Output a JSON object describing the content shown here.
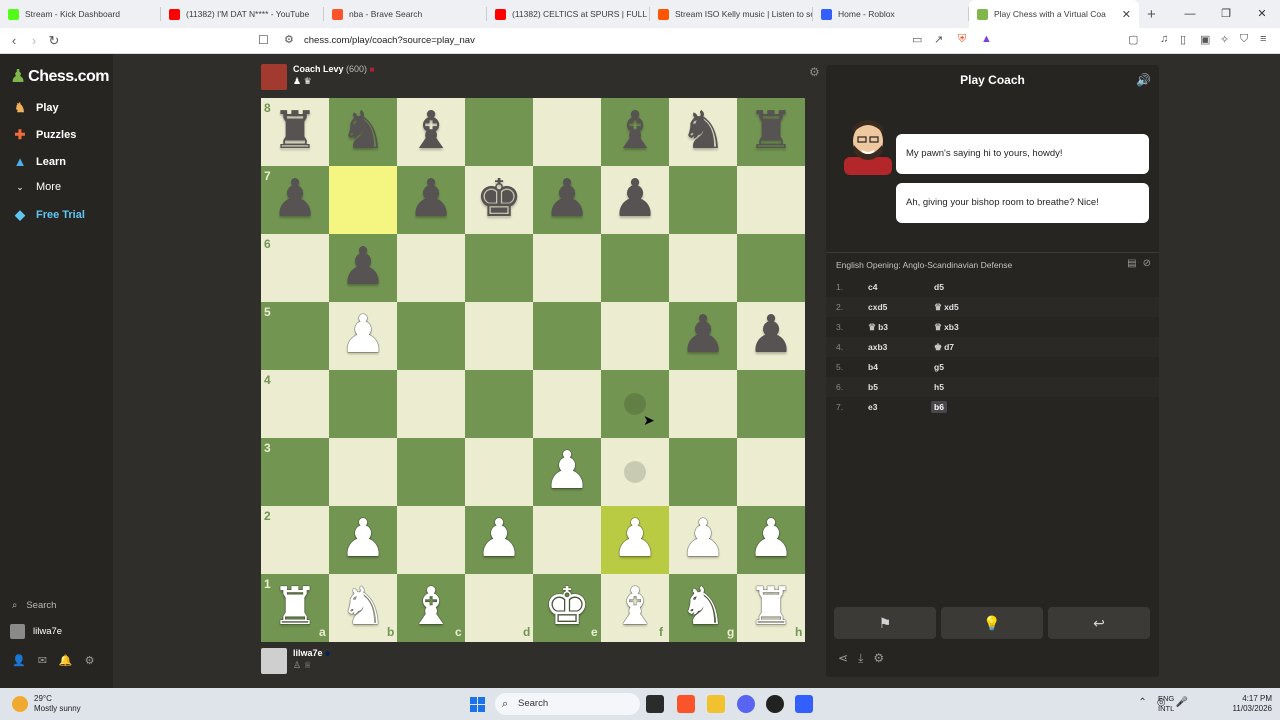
{
  "browser": {
    "tabs": [
      {
        "title": "Stream - Kick Dashboard",
        "color": "#53fc18"
      },
      {
        "title": "(11382) I'M DAT N**** - YouTube",
        "color": "#ff0000"
      },
      {
        "title": "nba - Brave Search",
        "color": "#fb542b"
      },
      {
        "title": "(11382) CELTICS at SPURS | FULL GA",
        "color": "#ff0000"
      },
      {
        "title": "Stream ISO Kelly music | Listen to so",
        "color": "#ff5500"
      },
      {
        "title": "Home - Roblox",
        "color": "#335fff"
      },
      {
        "title": "Play Chess with a Virtual Coa",
        "color": "#81b64c"
      }
    ],
    "url": "chess.com/play/coach?source=play_nav"
  },
  "sidebar": {
    "logo_text": "Chess.com",
    "items": [
      {
        "label": "Play",
        "icon": "play-hand-icon"
      },
      {
        "label": "Puzzles",
        "icon": "puzzle-icon"
      },
      {
        "label": "Learn",
        "icon": "graduation-cap-icon"
      },
      {
        "label": "More",
        "icon": "chevron-down-icon"
      },
      {
        "label": "Free Trial",
        "icon": "diamond-icon"
      }
    ],
    "search_label": "Search",
    "username": "lilwa7e"
  },
  "top_player": {
    "name": "Coach Levy",
    "rating": "(600)"
  },
  "bottom_player": {
    "name": "lilwa7e"
  },
  "board": {
    "light_color": "#ebecd0",
    "dark_color": "#739552",
    "ranks": [
      "8",
      "7",
      "6",
      "5",
      "4",
      "3",
      "2",
      "1"
    ],
    "files": [
      "a",
      "b",
      "c",
      "d",
      "e",
      "f",
      "g",
      "h"
    ],
    "rows": [
      "rnb..bnr",
      "p.pkpp..",
      ".p......",
      ".P....pp",
      "........",
      "....P...",
      ".P.P.PPP",
      "RNB.KBNR"
    ],
    "highlights": [
      [
        1,
        1
      ],
      [
        6,
        5
      ]
    ],
    "hints": [
      [
        4,
        5
      ],
      [
        5,
        5
      ]
    ]
  },
  "panel": {
    "title": "Play Coach",
    "messages": [
      "My pawn's saying hi to yours, howdy!",
      "Ah, giving your bishop room to breathe? Nice!"
    ],
    "opening": "English Opening: Anglo-Scandinavian Defense",
    "moves": [
      {
        "num": "1.",
        "white": "c4",
        "black": "d5"
      },
      {
        "num": "2.",
        "white": "cxd5",
        "black": "xd5",
        "black_fig": "♛"
      },
      {
        "num": "3.",
        "white": "b3",
        "white_fig": "♛",
        "black": "xb3",
        "black_fig": "♛"
      },
      {
        "num": "4.",
        "white": "axb3",
        "black": "d7",
        "black_fig": "♚"
      },
      {
        "num": "5.",
        "white": "b4",
        "black": "g5"
      },
      {
        "num": "6.",
        "white": "b5",
        "black": "h5"
      },
      {
        "num": "7.",
        "white": "e3",
        "black": "b6"
      }
    ]
  },
  "taskbar": {
    "temperature": "29°C",
    "weather": "Mostly sunny",
    "search": "Search",
    "lang_top": "ENG",
    "lang_bottom": "INTL",
    "time": "4:17 PM",
    "date": "11/03/2026"
  }
}
